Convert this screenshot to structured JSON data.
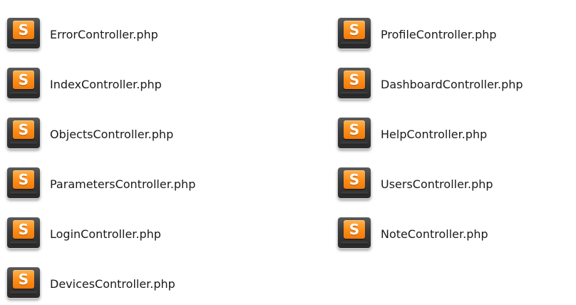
{
  "icon": {
    "name": "sublime-text-file-icon",
    "glyph": "S",
    "badge_color": "#ff8e1a",
    "tile_color": "#3a3a3a"
  },
  "files": {
    "left": [
      {
        "name": "ErrorController.php"
      },
      {
        "name": "IndexController.php"
      },
      {
        "name": "ObjectsController.php"
      },
      {
        "name": "ParametersController.php"
      },
      {
        "name": "LoginController.php"
      },
      {
        "name": "DevicesController.php"
      }
    ],
    "right": [
      {
        "name": "ProfileController.php"
      },
      {
        "name": "DashboardController.php"
      },
      {
        "name": "HelpController.php"
      },
      {
        "name": "UsersController.php"
      },
      {
        "name": "NoteController.php"
      }
    ]
  }
}
